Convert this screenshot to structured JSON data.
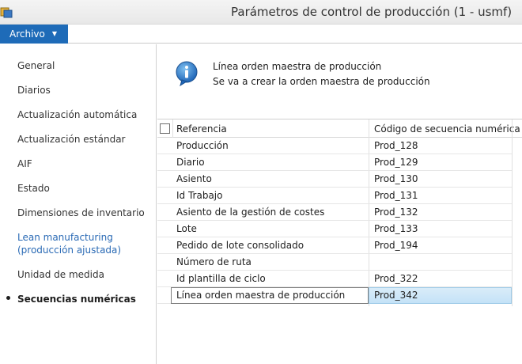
{
  "window": {
    "title": "Parámetros de control de producción (1 - usmf)"
  },
  "ribbon": {
    "file_label": "Archivo"
  },
  "nav": {
    "items": [
      {
        "label": "General"
      },
      {
        "label": "Diarios"
      },
      {
        "label": "Actualización automática"
      },
      {
        "label": "Actualización estándar"
      },
      {
        "label": "AIF"
      },
      {
        "label": "Estado"
      },
      {
        "label": "Dimensiones de inventario"
      },
      {
        "label_line1": "Lean manufacturing",
        "label_line2": "(producción ajustada)"
      },
      {
        "label": "Unidad de medida"
      },
      {
        "label": "Secuencias numéricas"
      }
    ],
    "active_index": 9
  },
  "info": {
    "title": "Línea orden maestra de producción",
    "message": "Se va a crear la orden maestra de producción"
  },
  "grid": {
    "columns": {
      "reference": "Referencia",
      "sequence_code": "Código de secuencia numérica"
    },
    "rows": [
      {
        "reference": "Producción",
        "code": "Prod_128"
      },
      {
        "reference": "Diario",
        "code": "Prod_129"
      },
      {
        "reference": "Asiento",
        "code": "Prod_130"
      },
      {
        "reference": "Id Trabajo",
        "code": "Prod_131"
      },
      {
        "reference": "Asiento de la gestión de costes",
        "code": "Prod_132"
      },
      {
        "reference": "Lote",
        "code": "Prod_133"
      },
      {
        "reference": "Pedido de lote consolidado",
        "code": "Prod_194"
      },
      {
        "reference": "Número de ruta",
        "code": ""
      },
      {
        "reference": "Id plantilla de ciclo",
        "code": "Prod_322"
      },
      {
        "reference": "Línea orden maestra de producción",
        "code": "Prod_342"
      }
    ],
    "selected_index": 9
  },
  "colors": {
    "accent": "#1e6bb8",
    "link": "#2a6ab5",
    "selection": "#c4e2f7"
  },
  "icons": {
    "app": "app-icon",
    "info": "info-icon",
    "dropdown": "chevron-down-icon"
  }
}
